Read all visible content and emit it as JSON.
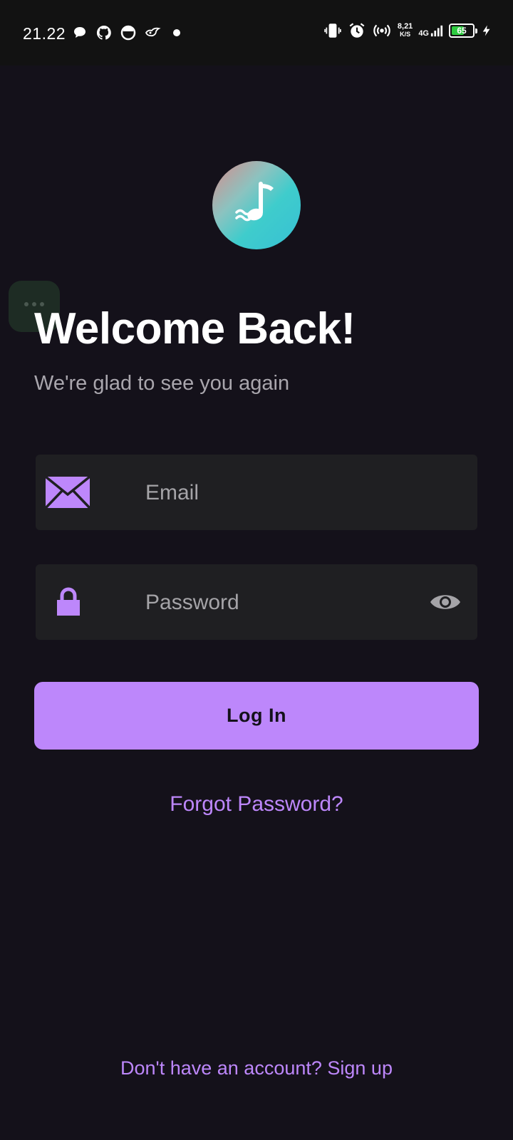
{
  "status_bar": {
    "time": "21.22",
    "net_speed_value": "8,21",
    "net_speed_unit": "K/S",
    "network_type": "4G",
    "battery_level": "65",
    "battery_fraction": 0.65,
    "icons_left": [
      "chat-bubble-icon",
      "github-icon",
      "circle-app-icon",
      "bird-icon",
      "dot-icon"
    ],
    "icons_right": [
      "vibrate-icon",
      "alarm-icon",
      "hotspot-icon",
      "signal-icon",
      "battery-icon",
      "charging-icon"
    ]
  },
  "logo": {
    "icon": "music-note-wave-icon"
  },
  "header": {
    "title": "Welcome Back!",
    "subtitle": "We're glad to see you again"
  },
  "form": {
    "email": {
      "placeholder": "Email",
      "value": "",
      "icon": "mail-icon"
    },
    "password": {
      "placeholder": "Password",
      "value": "",
      "icon": "lock-icon",
      "toggle_icon": "eye-icon"
    },
    "login_label": "Log In",
    "forgot_label": "Forgot Password?"
  },
  "footer": {
    "signup_label": "Don't have an account? Sign up"
  },
  "colors": {
    "background": "#14111a",
    "accent": "#bd87fb",
    "field": "#1f1f22"
  }
}
